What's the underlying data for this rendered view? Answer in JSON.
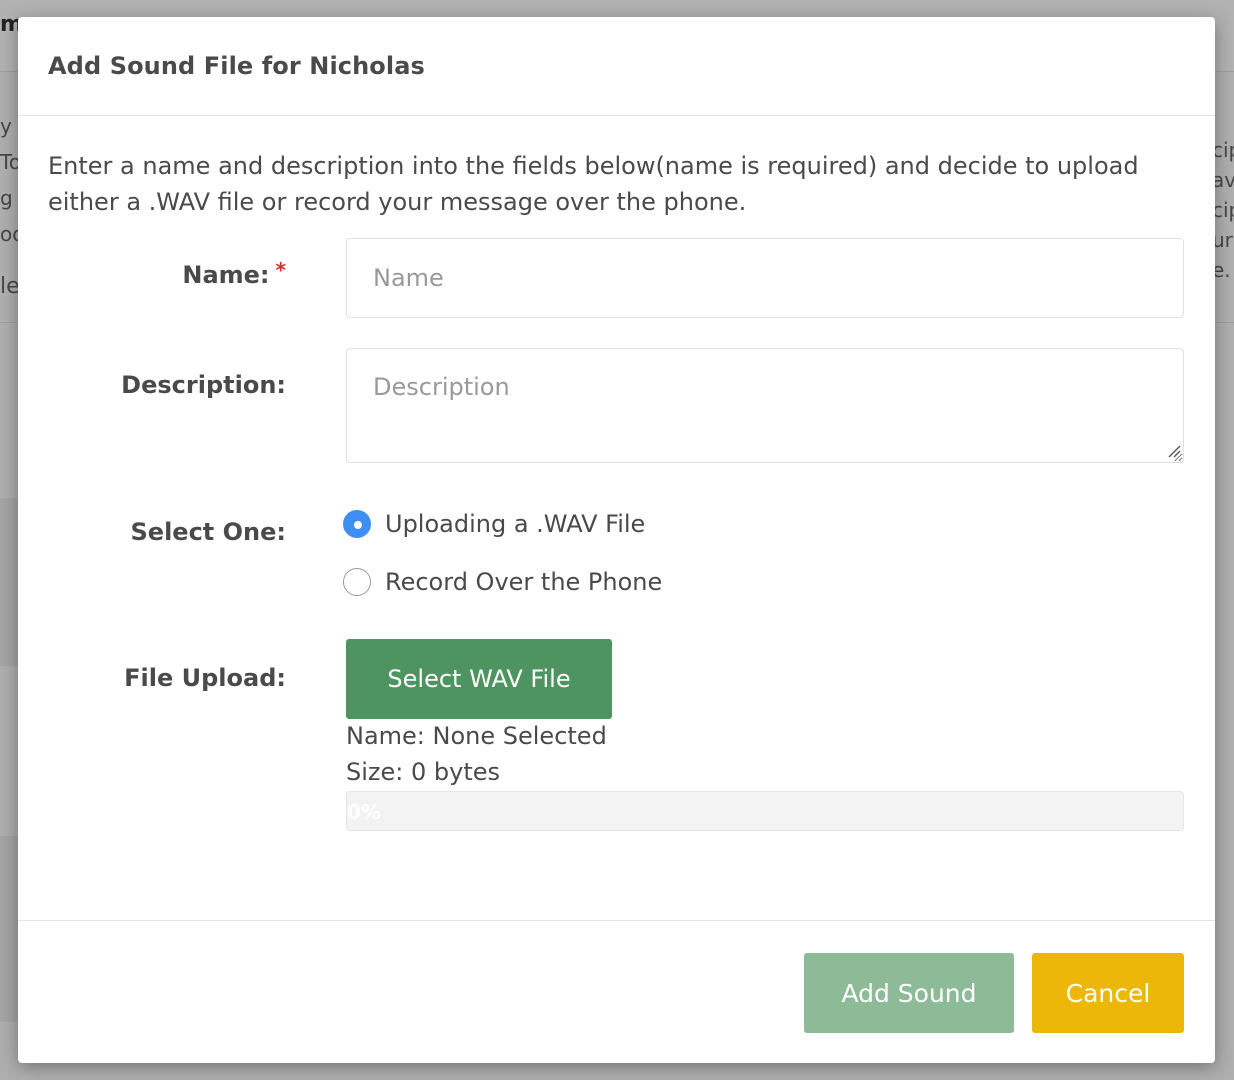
{
  "background": {
    "title": "m",
    "left_fragments": [
      "y s",
      "To",
      "g a",
      "oo",
      "le"
    ],
    "right_fragments": [
      "cip",
      "av",
      "cip",
      "uri",
      "e."
    ]
  },
  "modal": {
    "title": "Add Sound File for Nicholas",
    "intro": "Enter a name and description into the fields below(name is required) and decide to upload either a .WAV file or record your message over the phone.",
    "name_field": {
      "label": "Name:",
      "required_marker": "*",
      "value": "",
      "placeholder": "Name"
    },
    "description_field": {
      "label": "Description:",
      "value": "",
      "placeholder": "Description"
    },
    "select_one": {
      "label": "Select One:",
      "options": [
        {
          "label": "Uploading a .WAV File",
          "checked": true
        },
        {
          "label": "Record Over the Phone",
          "checked": false
        }
      ]
    },
    "file_upload": {
      "label": "File Upload:",
      "button_label": "Select WAV File",
      "name_text": "Name: None Selected",
      "size_text": "Size: 0 bytes",
      "progress_percent": 0,
      "progress_text": "0%"
    },
    "footer": {
      "add_label": "Add Sound",
      "cancel_label": "Cancel"
    }
  },
  "colors": {
    "select_button": "#4e9461",
    "add_button": "#8dbb98",
    "cancel_button": "#edb70a",
    "radio_checked": "#3d8ef5",
    "required": "#e02b2b"
  }
}
